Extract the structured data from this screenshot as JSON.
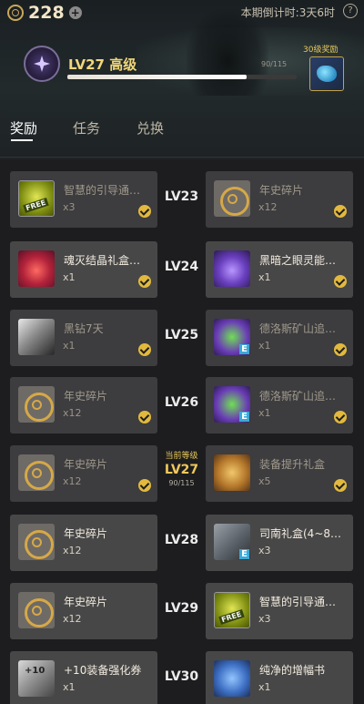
{
  "header": {
    "currency_amount": "228",
    "countdown": "本期倒计时:3天6时",
    "level_title": "LV27 高级",
    "progress_text": "90/115",
    "progress_fraction": 0.78,
    "reward_tag": "30级奖励"
  },
  "tabs": [
    {
      "label": "奖励"
    },
    {
      "label": "任务"
    },
    {
      "label": "兑换"
    }
  ],
  "rows": [
    {
      "level": "LV23",
      "left": {
        "name": "智慧的引导通…",
        "qty": "x3",
        "icon": "free-pass-icon"
      },
      "right": {
        "name": "年史碎片",
        "qty": "x12",
        "icon": "coin-fragment-icon"
      }
    },
    {
      "level": "LV24",
      "left": {
        "name": "魂灭结晶礼盒…",
        "qty": "x1",
        "icon": "red-crystal-icon"
      },
      "right": {
        "name": "黑暗之眼灵能…",
        "qty": "x1",
        "icon": "purple-crystal-icon"
      }
    },
    {
      "level": "LV25",
      "left": {
        "name": "黑钻7天",
        "qty": "x1",
        "icon": "black-diamond-icon"
      },
      "right": {
        "name": "德洛斯矿山追…",
        "qty": "x1",
        "icon": "gift-box-icon"
      }
    },
    {
      "level": "LV26",
      "left": {
        "name": "年史碎片",
        "qty": "x12",
        "icon": "coin-fragment-icon"
      },
      "right": {
        "name": "德洛斯矿山追…",
        "qty": "x1",
        "icon": "gift-box-icon"
      }
    },
    {
      "level": "LV27",
      "current_label": "当前等级",
      "current_progress": "90/115",
      "left": {
        "name": "年史碎片",
        "qty": "x12",
        "icon": "coin-fragment-icon"
      },
      "right": {
        "name": "装备提升礼盒",
        "qty": "x5",
        "icon": "treasure-chest-icon"
      }
    },
    {
      "level": "LV28",
      "left": {
        "name": "年史碎片",
        "qty": "x12",
        "icon": "coin-fragment-icon"
      },
      "right": {
        "name": "司南礼盒(4~8…",
        "qty": "x3",
        "icon": "metal-box-icon"
      }
    },
    {
      "level": "LV29",
      "left": {
        "name": "年史碎片",
        "qty": "x12",
        "icon": "coin-fragment-icon"
      },
      "right": {
        "name": "智慧的引导通…",
        "qty": "x3",
        "icon": "free-pass-icon"
      }
    },
    {
      "level": "LV30",
      "left": {
        "name": "+10装备强化券",
        "qty": "x1",
        "icon": "enhance-ticket-icon"
      },
      "right": {
        "name": "纯净的增幅书",
        "qty": "x1",
        "icon": "amplify-book-icon"
      }
    }
  ]
}
